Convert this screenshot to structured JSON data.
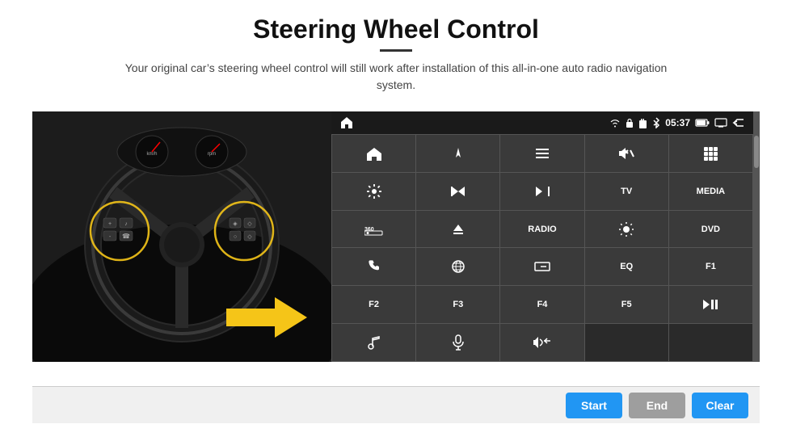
{
  "header": {
    "title": "Steering Wheel Control",
    "divider": true,
    "subtitle": "Your original car’s steering wheel control will still work after installation of this all-in-one auto radio navigation system."
  },
  "status_bar": {
    "time": "05:37",
    "icons": [
      "wifi",
      "lock",
      "sd",
      "bluetooth",
      "battery",
      "screen"
    ]
  },
  "button_grid": [
    [
      {
        "icon": "⌂",
        "label": "",
        "type": "icon"
      },
      {
        "icon": "↗",
        "label": "",
        "type": "icon"
      },
      {
        "icon": "☰",
        "label": "",
        "type": "icon"
      },
      {
        "icon": "🔇",
        "label": "×",
        "type": "icon"
      },
      {
        "icon": "⊞",
        "label": "",
        "type": "icon"
      }
    ],
    [
      {
        "icon": "⚙",
        "label": "",
        "type": "icon"
      },
      {
        "icon": "⏮",
        "label": "",
        "type": "icon"
      },
      {
        "icon": "⏭",
        "label": "",
        "type": "icon"
      },
      {
        "icon": "TV",
        "label": "",
        "type": "text"
      },
      {
        "icon": "MEDIA",
        "label": "",
        "type": "text"
      }
    ],
    [
      {
        "icon": "360",
        "label": "",
        "type": "icon"
      },
      {
        "icon": "▲",
        "label": "",
        "type": "icon"
      },
      {
        "icon": "RADIO",
        "label": "",
        "type": "text"
      },
      {
        "icon": "☀",
        "label": "",
        "type": "icon"
      },
      {
        "icon": "DVD",
        "label": "",
        "type": "text"
      }
    ],
    [
      {
        "icon": "📞",
        "label": "",
        "type": "icon"
      },
      {
        "icon": "🌐",
        "label": "",
        "type": "icon"
      },
      {
        "icon": "▭",
        "label": "",
        "type": "icon"
      },
      {
        "icon": "EQ",
        "label": "",
        "type": "text"
      },
      {
        "icon": "F1",
        "label": "",
        "type": "text"
      }
    ],
    [
      {
        "icon": "F2",
        "label": "",
        "type": "text"
      },
      {
        "icon": "F3",
        "label": "",
        "type": "text"
      },
      {
        "icon": "F4",
        "label": "",
        "type": "text"
      },
      {
        "icon": "F5",
        "label": "",
        "type": "text"
      },
      {
        "icon": "▶⏸",
        "label": "",
        "type": "icon"
      }
    ],
    [
      {
        "icon": "♪",
        "label": "",
        "type": "icon"
      },
      {
        "icon": "🎤",
        "label": "",
        "type": "icon"
      },
      {
        "icon": "🔊",
        "label": "",
        "type": "icon"
      },
      {
        "icon": "",
        "label": "",
        "type": "empty"
      },
      {
        "icon": "",
        "label": "",
        "type": "empty"
      }
    ]
  ],
  "actions": {
    "start_label": "Start",
    "end_label": "End",
    "clear_label": "Clear"
  },
  "colors": {
    "accent_blue": "#2196F3",
    "btn_end_gray": "#9e9e9e",
    "panel_bg": "#2a2a2a",
    "statusbar_bg": "#1a1a1a"
  }
}
